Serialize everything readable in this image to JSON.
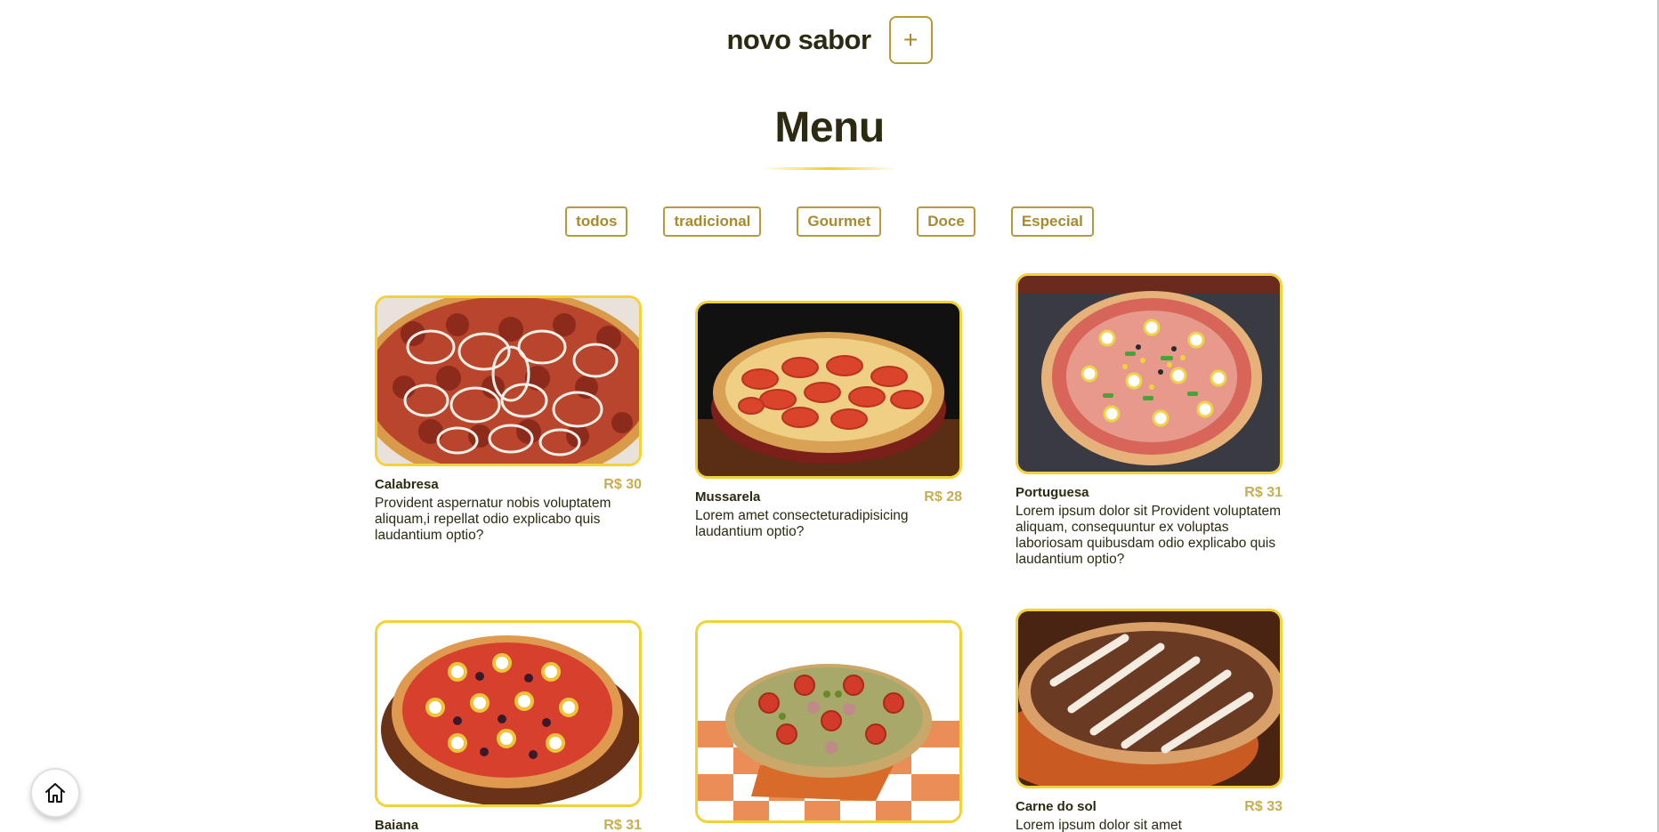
{
  "header": {
    "title": "novo sabor",
    "add_label": "+"
  },
  "menu": {
    "heading": "Menu"
  },
  "filters": [
    "todos",
    "tradicional",
    "Gourmet",
    "Doce",
    "Especial"
  ],
  "cards": [
    {
      "name": "Calabresa",
      "price": "R$ 30",
      "description": "Provident aspernatur nobis voluptatem aliquam,i repellat odio explicabo quis laudantium optio?"
    },
    {
      "name": "Mussarela",
      "price": "R$ 28",
      "description": "Lorem amet consecteturadipisicing laudantium optio?"
    },
    {
      "name": "Portuguesa",
      "price": "R$ 31",
      "description": "Lorem ipsum dolor sit Provident voluptatem aliquam, consequuntur ex voluptas laboriosam quibusdam odio explicabo quis laudantium optio?"
    },
    {
      "name": "Baiana",
      "price": "R$ 31",
      "description": ""
    },
    {
      "name": "",
      "price": "",
      "description": ""
    },
    {
      "name": "Carne do sol",
      "price": "R$ 33",
      "description": "Lorem ipsum dolor sit amet"
    }
  ],
  "icons": {
    "home": "home-icon",
    "add": "plus-icon"
  },
  "colors": {
    "accent": "#b89a3a",
    "price": "#c8ad52",
    "card_border": "#f3d13a",
    "text": "#2c2a10"
  }
}
